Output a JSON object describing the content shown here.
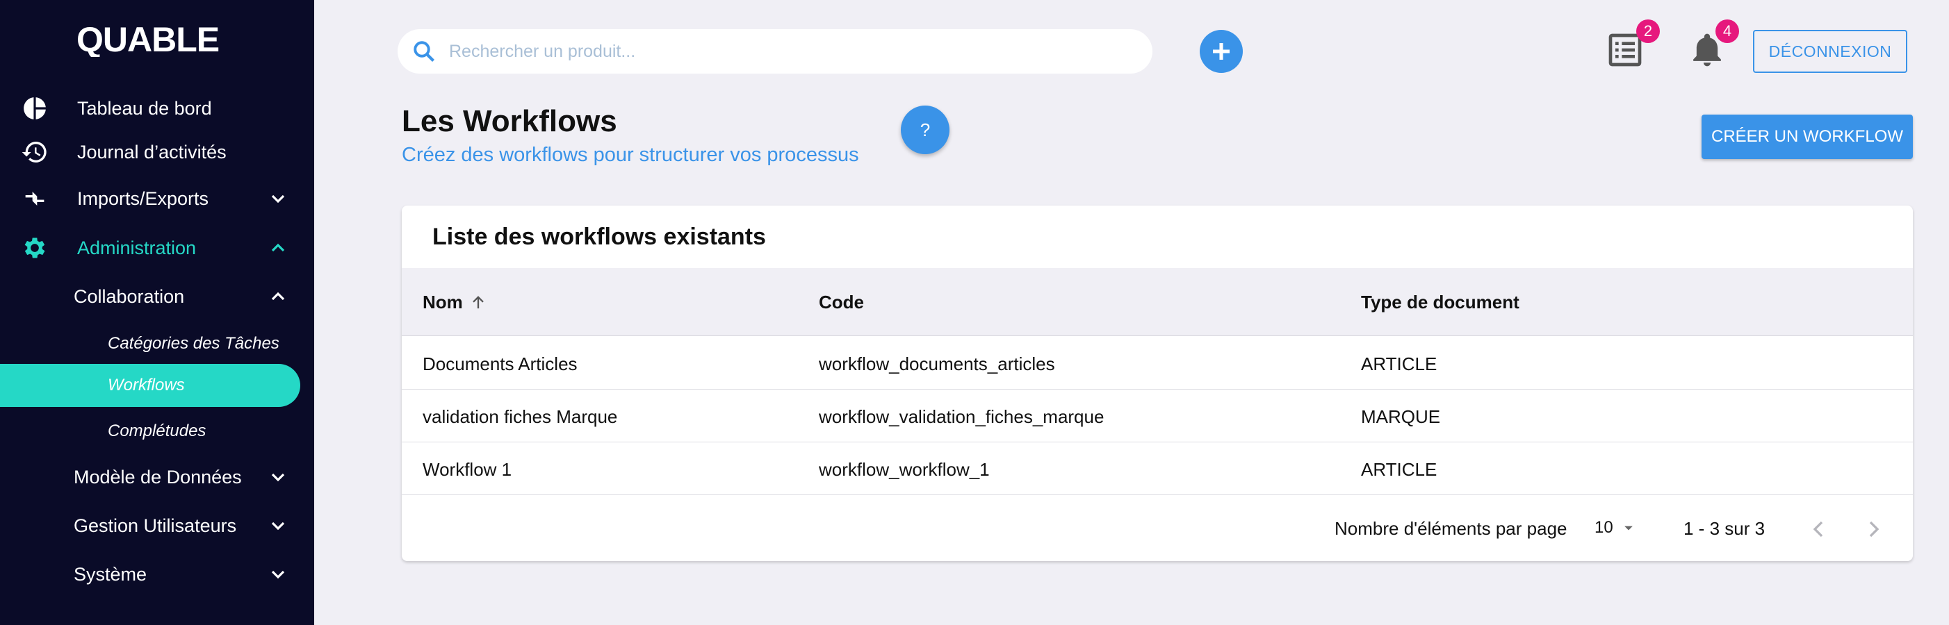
{
  "brand": {
    "logo_text": "QUABLE",
    "accent": "#25d8c6",
    "primary": "#3a93e8",
    "sidebar_bg": "#0a0b28"
  },
  "sidebar": {
    "items": [
      {
        "label": "Tableau de bord",
        "icon": "pie-chart-icon"
      },
      {
        "label": "Journal d’activités",
        "icon": "history-icon"
      },
      {
        "label": "Imports/Exports",
        "icon": "import-export-icon",
        "expanded": false
      },
      {
        "label": "Administration",
        "icon": "gear-icon",
        "expanded": true,
        "active": true
      }
    ],
    "admin_children": [
      {
        "label": "Collaboration",
        "expanded": true
      },
      {
        "label": "Modèle de Données",
        "expanded": false
      },
      {
        "label": "Gestion Utilisateurs",
        "expanded": false
      },
      {
        "label": "Système",
        "expanded": false
      }
    ],
    "collab_children": [
      {
        "label": "Catégories des Tâches"
      },
      {
        "label": "Workflows",
        "selected": true
      },
      {
        "label": "Complétudes"
      }
    ]
  },
  "topbar": {
    "search_placeholder": "Rechercher un produit...",
    "tasks_badge": "2",
    "notifications_badge": "4",
    "logout_label": "DÉCONNEXION"
  },
  "page": {
    "title": "Les Workflows",
    "subtitle": "Créez des workflows pour structurer vos processus",
    "help_label": "?",
    "create_label": "CRÉER UN WORKFLOW"
  },
  "table": {
    "title": "Liste des workflows existants",
    "columns": [
      "Nom",
      "Code",
      "Type de document"
    ],
    "sort_column": "Nom",
    "rows": [
      [
        "Documents Articles",
        "workflow_documents_articles",
        "ARTICLE"
      ],
      [
        "validation fiches Marque",
        "workflow_validation_fiches_marque",
        "MARQUE"
      ],
      [
        "Workflow 1",
        "workflow_workflow_1",
        "ARTICLE"
      ]
    ],
    "footer": {
      "per_page_label": "Nombre d'éléments par page",
      "per_page_value": "10",
      "range_label": "1 - 3 sur 3"
    }
  }
}
